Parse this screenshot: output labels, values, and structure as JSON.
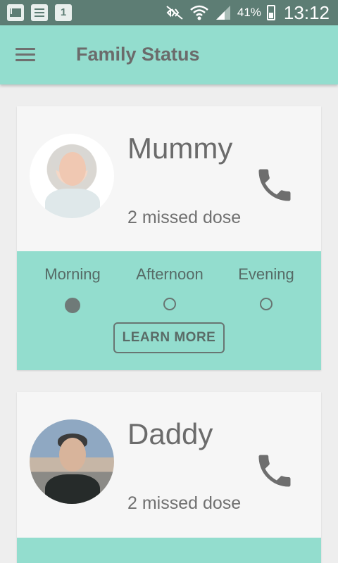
{
  "status_bar": {
    "calendar_day": "1",
    "battery_percent": "41%",
    "time": "13:12",
    "icons": [
      "gmail-icon",
      "notes-icon",
      "calendar-icon",
      "mute-icon",
      "wifi-icon",
      "signal-icon",
      "battery-icon"
    ]
  },
  "app_bar": {
    "title": "Family Status",
    "menu_icon": "hamburger-menu-icon"
  },
  "colors": {
    "accent": "#93ddce",
    "status_bar": "#5d7d74",
    "card": "#f6f6f6",
    "background": "#eeeeee",
    "text": "#6b6b6b"
  },
  "members": [
    {
      "name": "Mummy",
      "status": "2 missed dose",
      "schedule": [
        {
          "label": "Morning",
          "taken": true
        },
        {
          "label": "Afternoon",
          "taken": false
        },
        {
          "label": "Evening",
          "taken": false
        }
      ],
      "action_label": "LEARN MORE"
    },
    {
      "name": "Daddy",
      "status": "2 missed dose"
    }
  ]
}
